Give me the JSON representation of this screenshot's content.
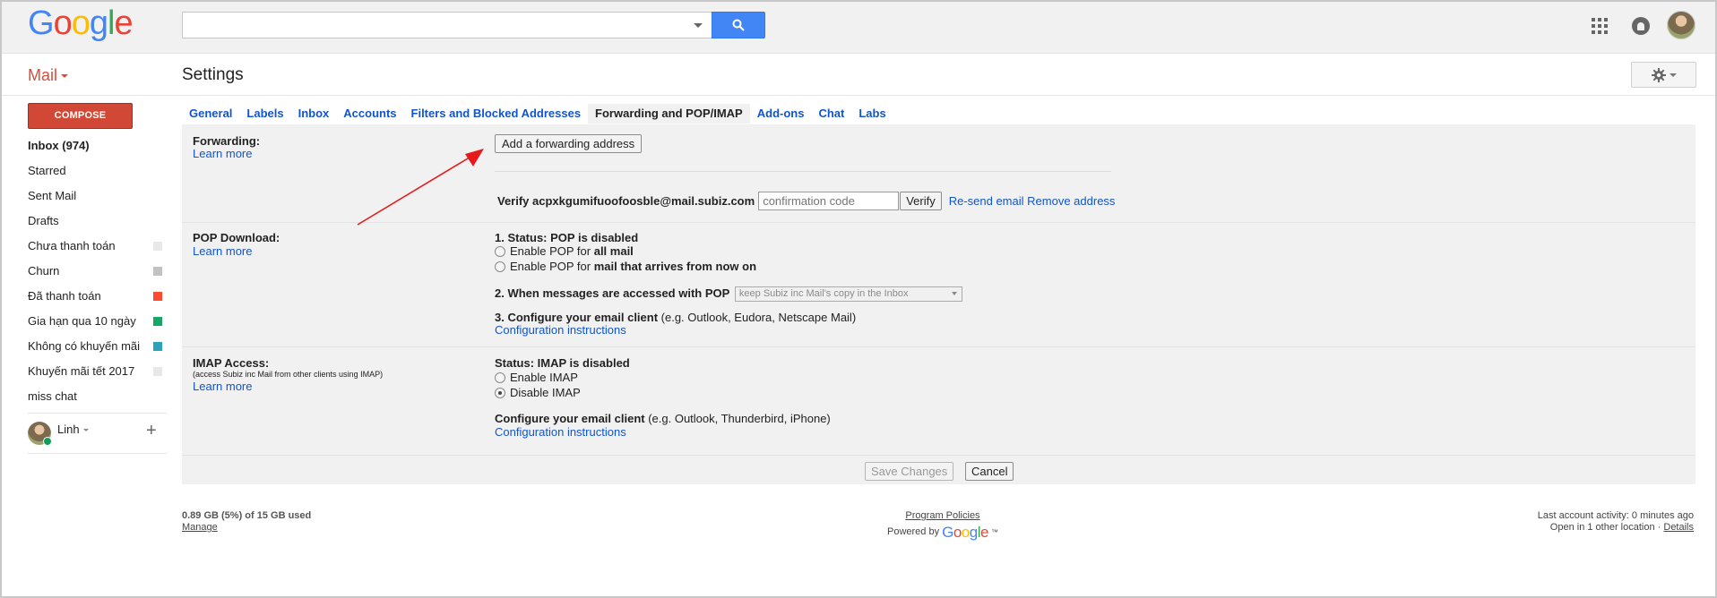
{
  "header": {
    "logo_letters": [
      {
        "ch": "G",
        "color": "#4285f4"
      },
      {
        "ch": "o",
        "color": "#ea4335"
      },
      {
        "ch": "o",
        "color": "#fbbc05"
      },
      {
        "ch": "g",
        "color": "#4285f4"
      },
      {
        "ch": "l",
        "color": "#34a853"
      },
      {
        "ch": "e",
        "color": "#ea4335"
      }
    ],
    "search_value": "",
    "icons": [
      "search-icon",
      "apps-grid-icon",
      "notifications-icon",
      "account-avatar"
    ]
  },
  "subbar": {
    "mail_label": "Mail",
    "page_title": "Settings"
  },
  "sidebar": {
    "compose_label": "COMPOSE",
    "items": [
      {
        "label": "Inbox (974)",
        "bold": true,
        "color": ""
      },
      {
        "label": "Starred",
        "bold": false,
        "color": ""
      },
      {
        "label": "Sent Mail",
        "bold": false,
        "color": ""
      },
      {
        "label": "Drafts",
        "bold": false,
        "color": ""
      },
      {
        "label": "Chưa thanh toán",
        "bold": false,
        "color": "#e8e8e8"
      },
      {
        "label": "Churn",
        "bold": false,
        "color": "#c2c2c2"
      },
      {
        "label": "Đã thanh toán",
        "bold": false,
        "color": "#fb4c2f"
      },
      {
        "label": "Gia hạn qua 10 ngày",
        "bold": false,
        "color": "#16a766"
      },
      {
        "label": "Không có khuyến mãi",
        "bold": false,
        "color": "#2da2bb"
      },
      {
        "label": "Khuyến mãi tết 2017",
        "bold": false,
        "color": "#e8e8e8"
      },
      {
        "label": "miss chat",
        "bold": false,
        "color": ""
      }
    ],
    "chat_user": "Linh",
    "chat_status_color": "#0f9d58"
  },
  "tabs": [
    {
      "label": "General",
      "active": false
    },
    {
      "label": "Labels",
      "active": false
    },
    {
      "label": "Inbox",
      "active": false
    },
    {
      "label": "Accounts",
      "active": false
    },
    {
      "label": "Filters and Blocked Addresses",
      "active": false
    },
    {
      "label": "Forwarding and POP/IMAP",
      "active": true
    },
    {
      "label": "Add-ons",
      "active": false
    },
    {
      "label": "Chat",
      "active": false
    },
    {
      "label": "Labs",
      "active": false
    }
  ],
  "forwarding": {
    "label": "Forwarding:",
    "learn_more": "Learn more",
    "add_button": "Add a forwarding address",
    "verify_prefix": "Verify acpxkgumifuoofoosble@mail.subiz.com",
    "code_placeholder": "confirmation code",
    "verify_button": "Verify",
    "resend_link": "Re-send email",
    "remove_link": "Remove address"
  },
  "pop": {
    "label": "POP Download:",
    "learn_more": "Learn more",
    "status": "1. Status: POP is disabled",
    "opt1_prefix": "Enable POP for ",
    "opt1_bold": "all mail",
    "opt2_prefix": "Enable POP for ",
    "opt2_bold": "mail that arrives from now on",
    "when_label": "2. When messages are accessed with POP",
    "when_select": "keep Subiz inc Mail's copy in the Inbox",
    "configure_bold": "3. Configure your email client",
    "configure_rest": " (e.g. Outlook, Eudora, Netscape Mail)",
    "config_link": "Configuration instructions"
  },
  "imap": {
    "label": "IMAP Access:",
    "sublabel": "(access Subiz inc Mail from other clients using IMAP)",
    "learn_more": "Learn more",
    "status": "Status: IMAP is disabled",
    "enable": "Enable IMAP",
    "disable": "Disable IMAP",
    "selected": "disable",
    "configure_bold": "Configure your email client",
    "configure_rest": " (e.g. Outlook, Thunderbird, iPhone)",
    "config_link": "Configuration instructions"
  },
  "actions": {
    "save": "Save Changes",
    "cancel": "Cancel"
  },
  "footer": {
    "usage": "0.89 GB (5%) of 15 GB used",
    "manage": "Manage",
    "program_policies": "Program Policies",
    "powered_by": "Powered by",
    "last_activity": "Last account activity: 0 minutes ago",
    "open_in": "Open in 1 other location",
    "separator": " · ",
    "details": "Details"
  },
  "colors": {
    "compose": "#d14836",
    "search_button": "#4285f4",
    "link": "#1155cc",
    "mail_label": "#dd4b39",
    "annotation_arrow": "#e8191b"
  }
}
